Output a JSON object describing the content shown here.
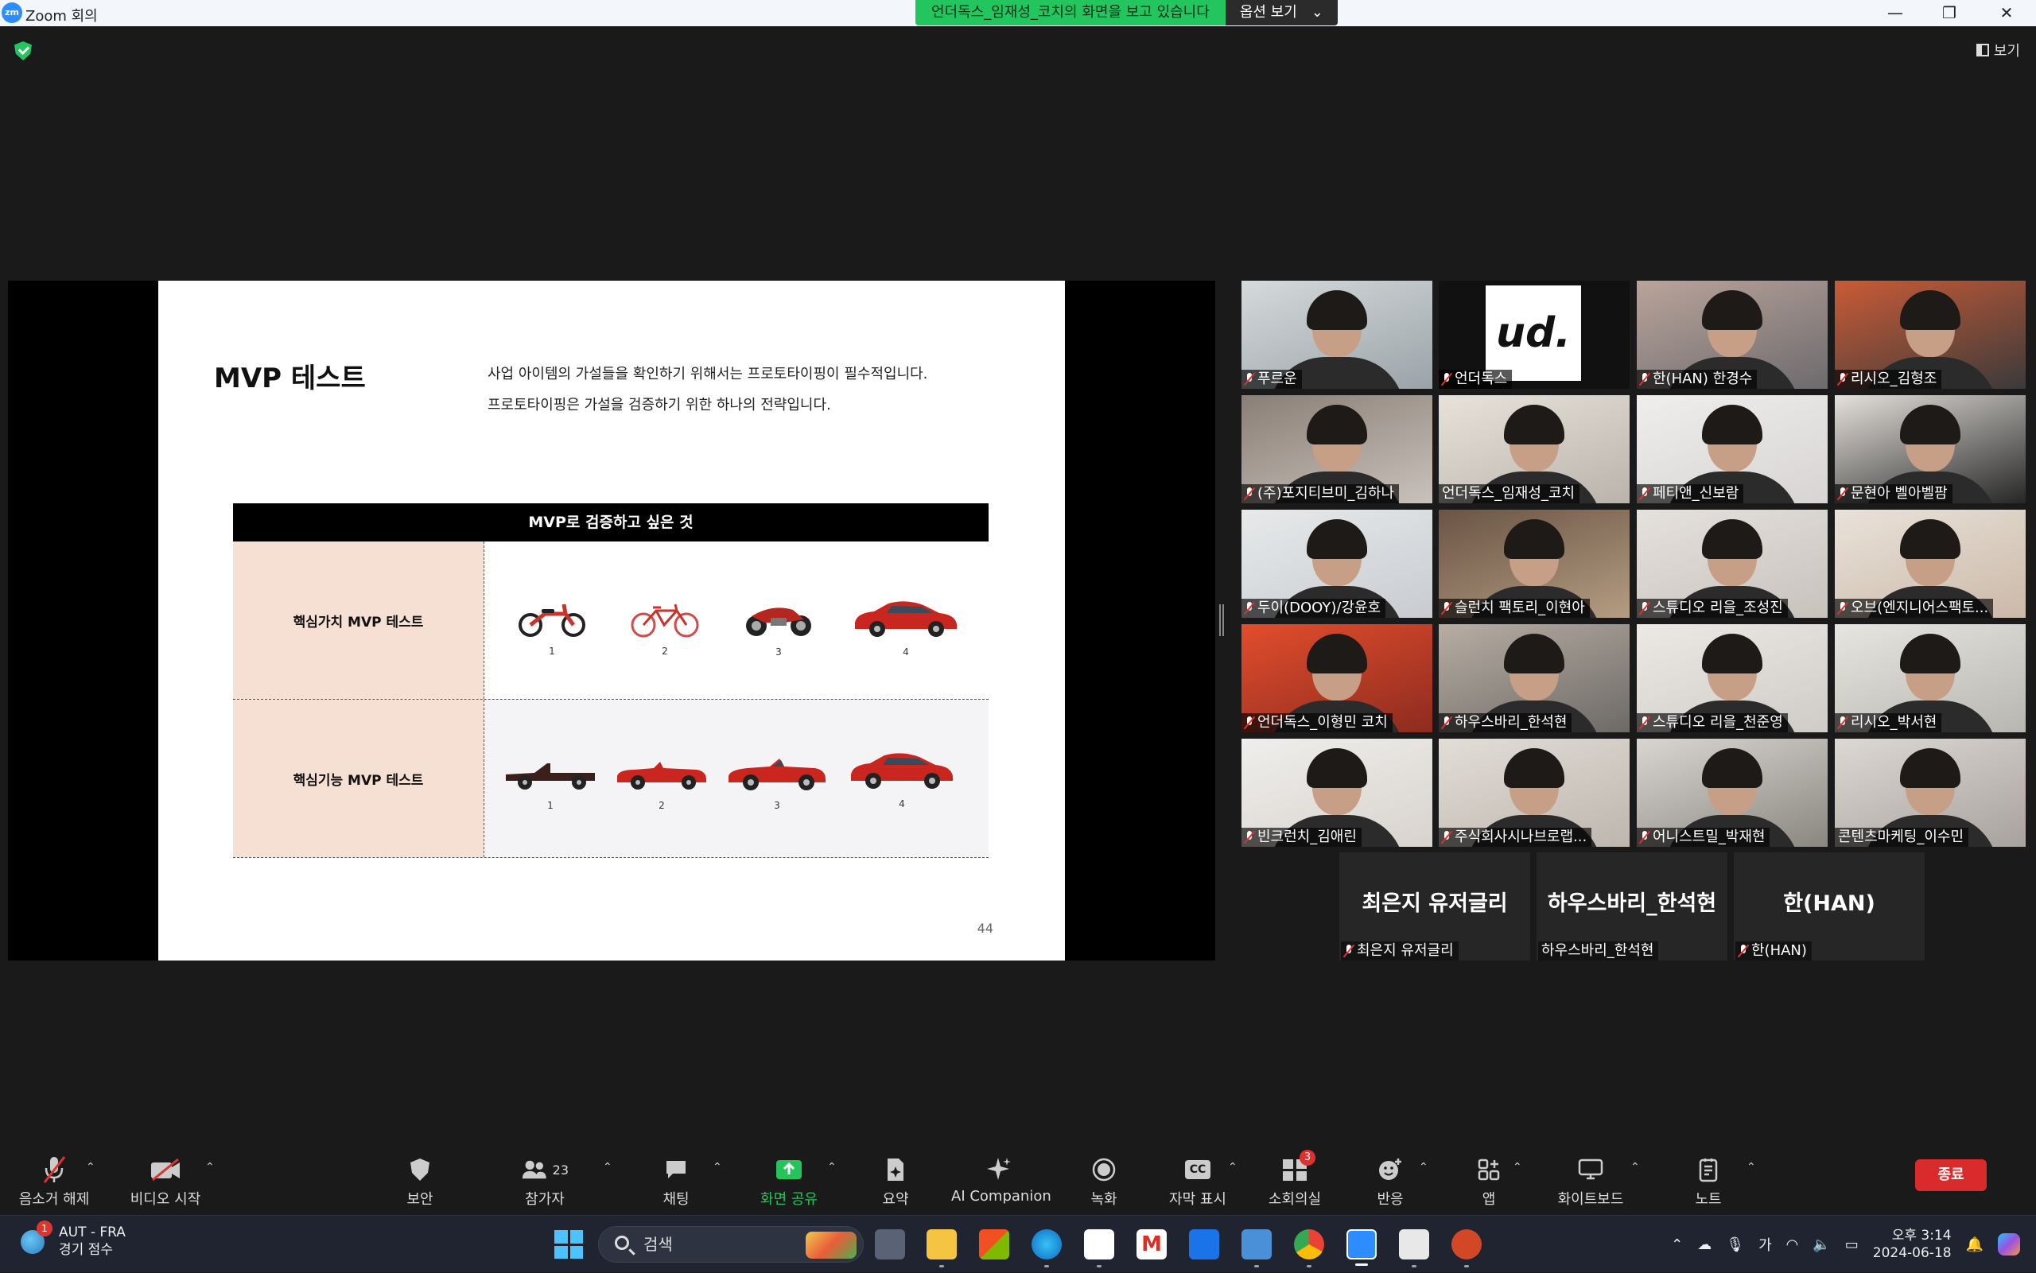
{
  "window": {
    "app_logo": "zm",
    "title": "Zoom 회의",
    "share_banner": "언더독스_임재성_코치의 화면을 보고 있습니다",
    "options_label": "옵션 보기",
    "view_label": "보기"
  },
  "slide": {
    "title": "MVP 테스트",
    "desc_line1": "사업 아이템의 가설들을 확인하기 위해서는 프로토타이핑이 필수적입니다.",
    "desc_line2": "프로토타이핑은 가설을 검증하기 위한 하나의 전략입니다.",
    "table_header": "MVP로 검증하고 싶은 것",
    "row1_label": "핵심가치 MVP 테스트",
    "row2_label": "핵심기능 MVP 테스트",
    "numbers": [
      "1",
      "2",
      "3",
      "4"
    ],
    "page": "44"
  },
  "participants": [
    {
      "name": "푸르운",
      "muted": true
    },
    {
      "name": "언더독스",
      "muted": true,
      "logo": "ud."
    },
    {
      "name": "한(HAN) 한경수",
      "muted": true
    },
    {
      "name": "리시오_김형조",
      "muted": true
    },
    {
      "name": "(주)포지티브미_김하나",
      "muted": true
    },
    {
      "name": "언더독스_임재성_코치",
      "muted": false,
      "active": true
    },
    {
      "name": "페티앤_신보람",
      "muted": true
    },
    {
      "name": "문현아 벨아벨팜",
      "muted": true
    },
    {
      "name": "두이(DOOY)/강윤호",
      "muted": true
    },
    {
      "name": "슬런치 팩토리_이현아",
      "muted": true
    },
    {
      "name": "스튜디오 리을_조성진",
      "muted": true
    },
    {
      "name": "오브(엔지니어스팩토...",
      "muted": true
    },
    {
      "name": "언더독스_이형민 코치",
      "muted": true
    },
    {
      "name": "하우스바리_한석현",
      "muted": true
    },
    {
      "name": "스튜디오 리을_천준영",
      "muted": true
    },
    {
      "name": "리시오_박서현",
      "muted": true
    },
    {
      "name": "빈크런치_김애린",
      "muted": true
    },
    {
      "name": "주식회사시나브로랩...",
      "muted": true
    },
    {
      "name": "어니스트밀_박재현",
      "muted": true
    },
    {
      "name": "콘텐츠마케팅_이수민",
      "muted": false
    }
  ],
  "name_tiles": [
    {
      "big": "최은지 유저글리",
      "small": "최은지 유저글리",
      "muted": true
    },
    {
      "big": "하우스바리_한석현",
      "small": "하우스바리_한석현",
      "muted": false
    },
    {
      "big": "한(HAN)",
      "small": "한(HAN)",
      "muted": true
    }
  ],
  "toolbar": {
    "unmute": "음소거 해제",
    "start_video": "비디오 시작",
    "security": "보안",
    "participants": "참가자",
    "participant_count": "23",
    "chat": "채팅",
    "share": "화면 공유",
    "summary": "요약",
    "ai": "AI Companion",
    "record": "녹화",
    "captions": "자막 표시",
    "captions_icon": "CC",
    "breakout": "소회의실",
    "breakout_badge": "3",
    "reactions": "반응",
    "apps": "앱",
    "whiteboard": "화이트보드",
    "notes": "노트",
    "end": "종료"
  },
  "taskbar": {
    "weather_title": "AUT - FRA",
    "weather_sub": "경기 점수",
    "weather_badge": "1",
    "search": "검색",
    "ime": "가",
    "time": "오후 3:14",
    "date": "2024-06-18"
  },
  "colors": {
    "zoom_blue": "#2d8cff",
    "share_green": "#23c55e",
    "end_red": "#d92b2b",
    "active_outline": "#c3e35b"
  }
}
